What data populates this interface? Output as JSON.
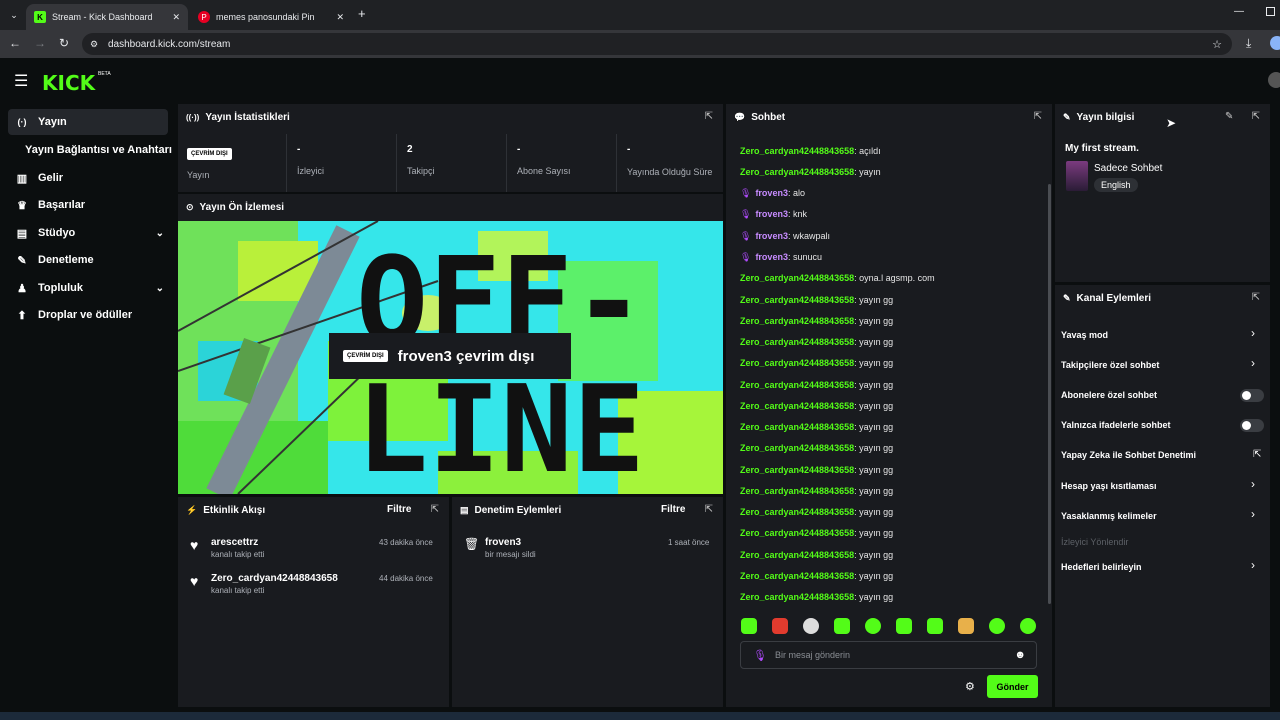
{
  "browser": {
    "tabs": [
      {
        "title": "Stream - Kick Dashboard",
        "active": true
      },
      {
        "title": "memes panosundaki Pin",
        "active": false
      }
    ],
    "url": "dashboard.kick.com/stream"
  },
  "brand": {
    "logo": "KICK",
    "beta": "BETA",
    "accent": "#53fc18"
  },
  "sidebar": {
    "items": [
      {
        "label": "Yayın",
        "icon": "broadcast-icon",
        "glyph": "(·)"
      },
      {
        "label": "Yayın Bağlantısı ve Anahtarı",
        "icon": "",
        "glyph": ""
      },
      {
        "label": "Gelir",
        "icon": "chart-icon",
        "glyph": "▥"
      },
      {
        "label": "Başarılar",
        "icon": "trophy-icon",
        "glyph": "♛"
      },
      {
        "label": "Stüdyo",
        "icon": "studio-icon",
        "glyph": "▤"
      },
      {
        "label": "Denetleme",
        "icon": "wrench-icon",
        "glyph": "✎"
      },
      {
        "label": "Topluluk",
        "icon": "community-icon",
        "glyph": "♟"
      },
      {
        "label": "Droplar ve ödüller",
        "icon": "drops-icon",
        "glyph": "⬆"
      }
    ]
  },
  "stats": {
    "title": "Yayın İstatistikleri",
    "status_badge": "ÇEVRİM DIŞI",
    "columns": [
      {
        "value": "",
        "label": "Yayın"
      },
      {
        "value": "-",
        "label": "İzleyici"
      },
      {
        "value": "2",
        "label": "Takipçi"
      },
      {
        "value": "-",
        "label": "Abone Sayısı"
      },
      {
        "value": "-",
        "label": "Yayında Olduğu Süre"
      }
    ]
  },
  "preview": {
    "title": "Yayın Ön İzlemesi",
    "badge": "ÇEVRİM DIŞI",
    "message": "froven3 çevrim dışı",
    "bg_text_top": "OFF-",
    "bg_text_bottom": "LINE"
  },
  "activity": {
    "title": "Etkinlik Akışı",
    "filter": "Filtre",
    "events": [
      {
        "user": "arescettrz",
        "action": "kanalı takip etti",
        "time": "43 dakika önce"
      },
      {
        "user": "Zero_cardyan42448843658",
        "action": "kanalı takip etti",
        "time": "44 dakika önce"
      }
    ]
  },
  "moderation": {
    "title": "Denetim Eylemleri",
    "filter": "Filtre",
    "events": [
      {
        "user": "froven3",
        "action": "bir mesajı sildi",
        "time": "1 saat önce"
      }
    ]
  },
  "chat": {
    "title": "Sohbet",
    "messages": [
      {
        "user": "Zero_cardyan42448843658",
        "text": "açıldı",
        "mod": false
      },
      {
        "user": "Zero_cardyan42448843658",
        "text": "yayın",
        "mod": false
      },
      {
        "user": "froven3",
        "text": "alo",
        "mod": true
      },
      {
        "user": "froven3",
        "text": "knk",
        "mod": true
      },
      {
        "user": "froven3",
        "text": "wkawpalı",
        "mod": true
      },
      {
        "user": "froven3",
        "text": "sunucu",
        "mod": true
      },
      {
        "user": "Zero_cardyan42448843658",
        "text": "oyna.l agsmp. com",
        "mod": false
      },
      {
        "user": "Zero_cardyan42448843658",
        "text": "yayın gg",
        "mod": false
      },
      {
        "user": "Zero_cardyan42448843658",
        "text": "yayın gg",
        "mod": false
      },
      {
        "user": "Zero_cardyan42448843658",
        "text": "yayın gg",
        "mod": false
      },
      {
        "user": "Zero_cardyan42448843658",
        "text": "yayın gg",
        "mod": false
      },
      {
        "user": "Zero_cardyan42448843658",
        "text": "yayın gg",
        "mod": false
      },
      {
        "user": "Zero_cardyan42448843658",
        "text": "yayın gg",
        "mod": false
      },
      {
        "user": "Zero_cardyan42448843658",
        "text": "yayın gg",
        "mod": false
      },
      {
        "user": "Zero_cardyan42448843658",
        "text": "yayın gg",
        "mod": false
      },
      {
        "user": "Zero_cardyan42448843658",
        "text": "yayın gg",
        "mod": false
      },
      {
        "user": "Zero_cardyan42448843658",
        "text": "yayın gg",
        "mod": false
      },
      {
        "user": "Zero_cardyan42448843658",
        "text": "yayın gg",
        "mod": false
      },
      {
        "user": "Zero_cardyan42448843658",
        "text": "yayın gg",
        "mod": false
      },
      {
        "user": "Zero_cardyan42448843658",
        "text": "yayın gg",
        "mod": false
      },
      {
        "user": "Zero_cardyan42448843658",
        "text": "yayın gg",
        "mod": false
      },
      {
        "user": "Zero_cardyan42448843658",
        "text": "yayın gg",
        "mod": false
      }
    ],
    "input_placeholder": "Bir mesaj gönderin",
    "send_label": "Gönder"
  },
  "stream_info": {
    "title": "Yayın bilgisi",
    "stream_title": "My first stream.",
    "category": "Sadece Sohbet",
    "language": "English"
  },
  "channel_actions": {
    "title": "Kanal Eylemleri",
    "items": [
      {
        "label": "Yavaş mod",
        "control": "arrow"
      },
      {
        "label": "Takipçilere özel sohbet",
        "control": "arrow"
      },
      {
        "label": "Abonelere özel sohbet",
        "control": "toggle"
      },
      {
        "label": "Yalnızca ifadelerle sohbet",
        "control": "toggle"
      },
      {
        "label": "Yapay Zeka ile Sohbet Denetimi",
        "control": "external"
      },
      {
        "label": "Hesap yaşı kısıtlaması",
        "control": "arrow"
      },
      {
        "label": "Yasaklanmış kelimeler",
        "control": "arrow"
      },
      {
        "label": "İzleyici Yönlendir",
        "control": "disabled"
      },
      {
        "label": "Hedefleri belirleyin",
        "control": "arrow"
      }
    ]
  }
}
